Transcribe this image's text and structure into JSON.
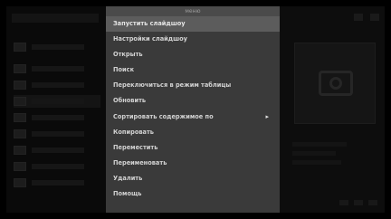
{
  "menu": {
    "title": "меню",
    "items": [
      {
        "label": "Запустить слайдшоу",
        "active": true
      },
      {
        "label": "Настройки слайдшоу"
      },
      {
        "label": "Открыть"
      },
      {
        "label": "Поиск"
      },
      {
        "label": "Переключиться в режим таблицы"
      },
      {
        "label": "Обновить"
      },
      {
        "label": "Сортировать содержимое по",
        "submenu_arrow": "▸"
      },
      {
        "label": "Копировать"
      },
      {
        "label": "Переместить"
      },
      {
        "label": "Переименовать"
      },
      {
        "label": "Удалить"
      },
      {
        "label": "Помощь"
      }
    ]
  },
  "icons": {
    "submenu": "chevron-right-icon",
    "preview": "camera-icon"
  },
  "colors": {
    "background": "#000000",
    "menu_bg": "#3a3a3a",
    "menu_highlight": "#5c5c5c",
    "menu_text": "#d2d2d2"
  }
}
